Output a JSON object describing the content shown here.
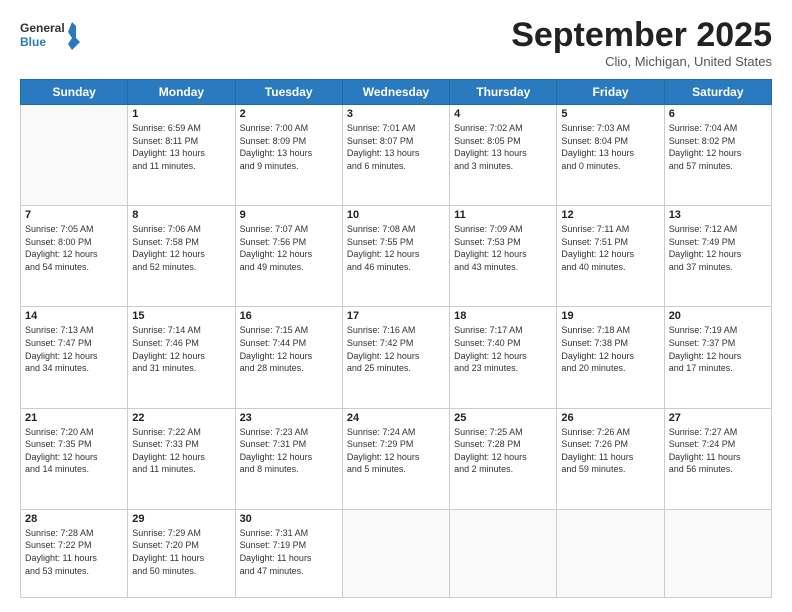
{
  "header": {
    "logo_general": "General",
    "logo_blue": "Blue",
    "month": "September 2025",
    "location": "Clio, Michigan, United States"
  },
  "weekdays": [
    "Sunday",
    "Monday",
    "Tuesday",
    "Wednesday",
    "Thursday",
    "Friday",
    "Saturday"
  ],
  "weeks": [
    [
      {
        "day": "",
        "lines": []
      },
      {
        "day": "1",
        "lines": [
          "Sunrise: 6:59 AM",
          "Sunset: 8:11 PM",
          "Daylight: 13 hours",
          "and 11 minutes."
        ]
      },
      {
        "day": "2",
        "lines": [
          "Sunrise: 7:00 AM",
          "Sunset: 8:09 PM",
          "Daylight: 13 hours",
          "and 9 minutes."
        ]
      },
      {
        "day": "3",
        "lines": [
          "Sunrise: 7:01 AM",
          "Sunset: 8:07 PM",
          "Daylight: 13 hours",
          "and 6 minutes."
        ]
      },
      {
        "day": "4",
        "lines": [
          "Sunrise: 7:02 AM",
          "Sunset: 8:05 PM",
          "Daylight: 13 hours",
          "and 3 minutes."
        ]
      },
      {
        "day": "5",
        "lines": [
          "Sunrise: 7:03 AM",
          "Sunset: 8:04 PM",
          "Daylight: 13 hours",
          "and 0 minutes."
        ]
      },
      {
        "day": "6",
        "lines": [
          "Sunrise: 7:04 AM",
          "Sunset: 8:02 PM",
          "Daylight: 12 hours",
          "and 57 minutes."
        ]
      }
    ],
    [
      {
        "day": "7",
        "lines": [
          "Sunrise: 7:05 AM",
          "Sunset: 8:00 PM",
          "Daylight: 12 hours",
          "and 54 minutes."
        ]
      },
      {
        "day": "8",
        "lines": [
          "Sunrise: 7:06 AM",
          "Sunset: 7:58 PM",
          "Daylight: 12 hours",
          "and 52 minutes."
        ]
      },
      {
        "day": "9",
        "lines": [
          "Sunrise: 7:07 AM",
          "Sunset: 7:56 PM",
          "Daylight: 12 hours",
          "and 49 minutes."
        ]
      },
      {
        "day": "10",
        "lines": [
          "Sunrise: 7:08 AM",
          "Sunset: 7:55 PM",
          "Daylight: 12 hours",
          "and 46 minutes."
        ]
      },
      {
        "day": "11",
        "lines": [
          "Sunrise: 7:09 AM",
          "Sunset: 7:53 PM",
          "Daylight: 12 hours",
          "and 43 minutes."
        ]
      },
      {
        "day": "12",
        "lines": [
          "Sunrise: 7:11 AM",
          "Sunset: 7:51 PM",
          "Daylight: 12 hours",
          "and 40 minutes."
        ]
      },
      {
        "day": "13",
        "lines": [
          "Sunrise: 7:12 AM",
          "Sunset: 7:49 PM",
          "Daylight: 12 hours",
          "and 37 minutes."
        ]
      }
    ],
    [
      {
        "day": "14",
        "lines": [
          "Sunrise: 7:13 AM",
          "Sunset: 7:47 PM",
          "Daylight: 12 hours",
          "and 34 minutes."
        ]
      },
      {
        "day": "15",
        "lines": [
          "Sunrise: 7:14 AM",
          "Sunset: 7:46 PM",
          "Daylight: 12 hours",
          "and 31 minutes."
        ]
      },
      {
        "day": "16",
        "lines": [
          "Sunrise: 7:15 AM",
          "Sunset: 7:44 PM",
          "Daylight: 12 hours",
          "and 28 minutes."
        ]
      },
      {
        "day": "17",
        "lines": [
          "Sunrise: 7:16 AM",
          "Sunset: 7:42 PM",
          "Daylight: 12 hours",
          "and 25 minutes."
        ]
      },
      {
        "day": "18",
        "lines": [
          "Sunrise: 7:17 AM",
          "Sunset: 7:40 PM",
          "Daylight: 12 hours",
          "and 23 minutes."
        ]
      },
      {
        "day": "19",
        "lines": [
          "Sunrise: 7:18 AM",
          "Sunset: 7:38 PM",
          "Daylight: 12 hours",
          "and 20 minutes."
        ]
      },
      {
        "day": "20",
        "lines": [
          "Sunrise: 7:19 AM",
          "Sunset: 7:37 PM",
          "Daylight: 12 hours",
          "and 17 minutes."
        ]
      }
    ],
    [
      {
        "day": "21",
        "lines": [
          "Sunrise: 7:20 AM",
          "Sunset: 7:35 PM",
          "Daylight: 12 hours",
          "and 14 minutes."
        ]
      },
      {
        "day": "22",
        "lines": [
          "Sunrise: 7:22 AM",
          "Sunset: 7:33 PM",
          "Daylight: 12 hours",
          "and 11 minutes."
        ]
      },
      {
        "day": "23",
        "lines": [
          "Sunrise: 7:23 AM",
          "Sunset: 7:31 PM",
          "Daylight: 12 hours",
          "and 8 minutes."
        ]
      },
      {
        "day": "24",
        "lines": [
          "Sunrise: 7:24 AM",
          "Sunset: 7:29 PM",
          "Daylight: 12 hours",
          "and 5 minutes."
        ]
      },
      {
        "day": "25",
        "lines": [
          "Sunrise: 7:25 AM",
          "Sunset: 7:28 PM",
          "Daylight: 12 hours",
          "and 2 minutes."
        ]
      },
      {
        "day": "26",
        "lines": [
          "Sunrise: 7:26 AM",
          "Sunset: 7:26 PM",
          "Daylight: 11 hours",
          "and 59 minutes."
        ]
      },
      {
        "day": "27",
        "lines": [
          "Sunrise: 7:27 AM",
          "Sunset: 7:24 PM",
          "Daylight: 11 hours",
          "and 56 minutes."
        ]
      }
    ],
    [
      {
        "day": "28",
        "lines": [
          "Sunrise: 7:28 AM",
          "Sunset: 7:22 PM",
          "Daylight: 11 hours",
          "and 53 minutes."
        ]
      },
      {
        "day": "29",
        "lines": [
          "Sunrise: 7:29 AM",
          "Sunset: 7:20 PM",
          "Daylight: 11 hours",
          "and 50 minutes."
        ]
      },
      {
        "day": "30",
        "lines": [
          "Sunrise: 7:31 AM",
          "Sunset: 7:19 PM",
          "Daylight: 11 hours",
          "and 47 minutes."
        ]
      },
      {
        "day": "",
        "lines": []
      },
      {
        "day": "",
        "lines": []
      },
      {
        "day": "",
        "lines": []
      },
      {
        "day": "",
        "lines": []
      }
    ]
  ]
}
